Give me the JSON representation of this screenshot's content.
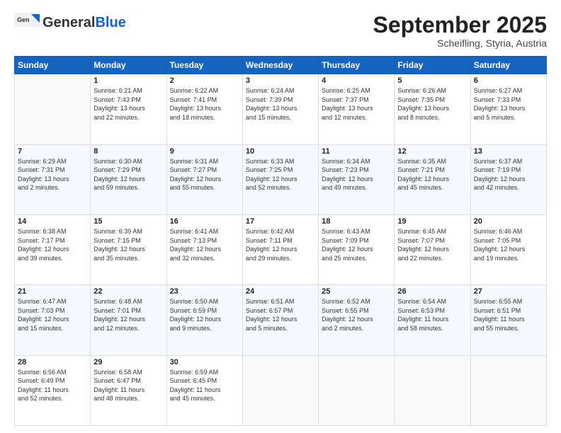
{
  "header": {
    "logo_general": "General",
    "logo_blue": "Blue",
    "month": "September 2025",
    "location": "Scheifling, Styria, Austria"
  },
  "days_of_week": [
    "Sunday",
    "Monday",
    "Tuesday",
    "Wednesday",
    "Thursday",
    "Friday",
    "Saturday"
  ],
  "weeks": [
    [
      {
        "day": "",
        "info": ""
      },
      {
        "day": "1",
        "info": "Sunrise: 6:21 AM\nSunset: 7:43 PM\nDaylight: 13 hours\nand 22 minutes."
      },
      {
        "day": "2",
        "info": "Sunrise: 6:22 AM\nSunset: 7:41 PM\nDaylight: 13 hours\nand 18 minutes."
      },
      {
        "day": "3",
        "info": "Sunrise: 6:24 AM\nSunset: 7:39 PM\nDaylight: 13 hours\nand 15 minutes."
      },
      {
        "day": "4",
        "info": "Sunrise: 6:25 AM\nSunset: 7:37 PM\nDaylight: 13 hours\nand 12 minutes."
      },
      {
        "day": "5",
        "info": "Sunrise: 6:26 AM\nSunset: 7:35 PM\nDaylight: 13 hours\nand 8 minutes."
      },
      {
        "day": "6",
        "info": "Sunrise: 6:27 AM\nSunset: 7:33 PM\nDaylight: 13 hours\nand 5 minutes."
      }
    ],
    [
      {
        "day": "7",
        "info": "Sunrise: 6:29 AM\nSunset: 7:31 PM\nDaylight: 13 hours\nand 2 minutes."
      },
      {
        "day": "8",
        "info": "Sunrise: 6:30 AM\nSunset: 7:29 PM\nDaylight: 12 hours\nand 59 minutes."
      },
      {
        "day": "9",
        "info": "Sunrise: 6:31 AM\nSunset: 7:27 PM\nDaylight: 12 hours\nand 55 minutes."
      },
      {
        "day": "10",
        "info": "Sunrise: 6:33 AM\nSunset: 7:25 PM\nDaylight: 12 hours\nand 52 minutes."
      },
      {
        "day": "11",
        "info": "Sunrise: 6:34 AM\nSunset: 7:23 PM\nDaylight: 12 hours\nand 49 minutes."
      },
      {
        "day": "12",
        "info": "Sunrise: 6:35 AM\nSunset: 7:21 PM\nDaylight: 12 hours\nand 45 minutes."
      },
      {
        "day": "13",
        "info": "Sunrise: 6:37 AM\nSunset: 7:19 PM\nDaylight: 12 hours\nand 42 minutes."
      }
    ],
    [
      {
        "day": "14",
        "info": "Sunrise: 6:38 AM\nSunset: 7:17 PM\nDaylight: 12 hours\nand 39 minutes."
      },
      {
        "day": "15",
        "info": "Sunrise: 6:39 AM\nSunset: 7:15 PM\nDaylight: 12 hours\nand 35 minutes."
      },
      {
        "day": "16",
        "info": "Sunrise: 6:41 AM\nSunset: 7:13 PM\nDaylight: 12 hours\nand 32 minutes."
      },
      {
        "day": "17",
        "info": "Sunrise: 6:42 AM\nSunset: 7:11 PM\nDaylight: 12 hours\nand 29 minutes."
      },
      {
        "day": "18",
        "info": "Sunrise: 6:43 AM\nSunset: 7:09 PM\nDaylight: 12 hours\nand 25 minutes."
      },
      {
        "day": "19",
        "info": "Sunrise: 6:45 AM\nSunset: 7:07 PM\nDaylight: 12 hours\nand 22 minutes."
      },
      {
        "day": "20",
        "info": "Sunrise: 6:46 AM\nSunset: 7:05 PM\nDaylight: 12 hours\nand 19 minutes."
      }
    ],
    [
      {
        "day": "21",
        "info": "Sunrise: 6:47 AM\nSunset: 7:03 PM\nDaylight: 12 hours\nand 15 minutes."
      },
      {
        "day": "22",
        "info": "Sunrise: 6:48 AM\nSunset: 7:01 PM\nDaylight: 12 hours\nand 12 minutes."
      },
      {
        "day": "23",
        "info": "Sunrise: 6:50 AM\nSunset: 6:59 PM\nDaylight: 12 hours\nand 9 minutes."
      },
      {
        "day": "24",
        "info": "Sunrise: 6:51 AM\nSunset: 6:57 PM\nDaylight: 12 hours\nand 5 minutes."
      },
      {
        "day": "25",
        "info": "Sunrise: 6:52 AM\nSunset: 6:55 PM\nDaylight: 12 hours\nand 2 minutes."
      },
      {
        "day": "26",
        "info": "Sunrise: 6:54 AM\nSunset: 6:53 PM\nDaylight: 11 hours\nand 58 minutes."
      },
      {
        "day": "27",
        "info": "Sunrise: 6:55 AM\nSunset: 6:51 PM\nDaylight: 11 hours\nand 55 minutes."
      }
    ],
    [
      {
        "day": "28",
        "info": "Sunrise: 6:56 AM\nSunset: 6:49 PM\nDaylight: 11 hours\nand 52 minutes."
      },
      {
        "day": "29",
        "info": "Sunrise: 6:58 AM\nSunset: 6:47 PM\nDaylight: 11 hours\nand 48 minutes."
      },
      {
        "day": "30",
        "info": "Sunrise: 6:59 AM\nSunset: 6:45 PM\nDaylight: 11 hours\nand 45 minutes."
      },
      {
        "day": "",
        "info": ""
      },
      {
        "day": "",
        "info": ""
      },
      {
        "day": "",
        "info": ""
      },
      {
        "day": "",
        "info": ""
      }
    ]
  ]
}
